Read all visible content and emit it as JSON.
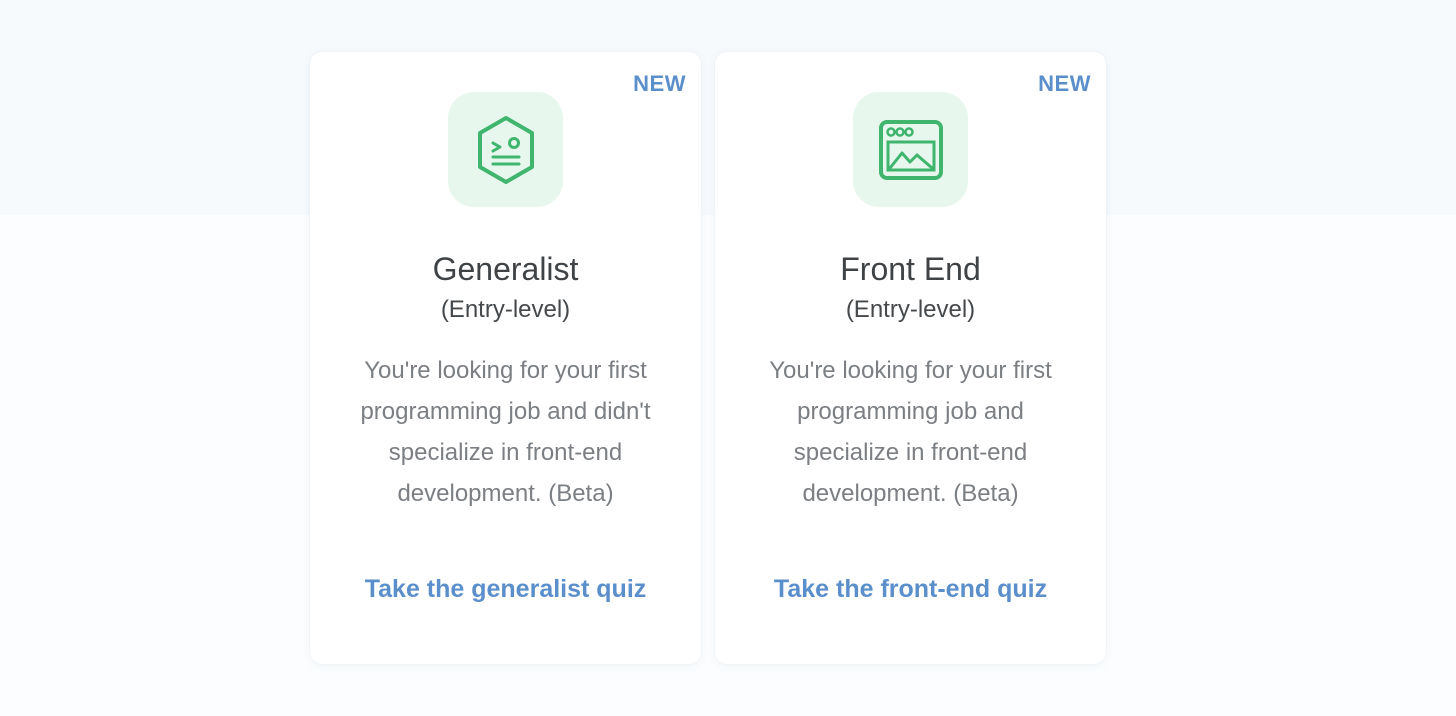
{
  "cards": [
    {
      "badge": "NEW",
      "icon": "terminal-hexagon-icon",
      "title": "Generalist",
      "subtitle": "(Entry-level)",
      "description_lines": [
        "You're looking for your first",
        "programming job and didn't",
        "specialize in front-end",
        "development. (Beta)"
      ],
      "cta": "Take the generalist quiz"
    },
    {
      "badge": "NEW",
      "icon": "browser-window-image-icon",
      "title": "Front End",
      "subtitle": "(Entry-level)",
      "description_lines": [
        "You're looking for your first",
        "programming job and",
        "specialize in front-end",
        "development. (Beta)"
      ],
      "cta": "Take the front-end quiz"
    }
  ],
  "colors": {
    "accent": "#5b8fcb",
    "icon_green": "#3fb56e",
    "icon_bg": "#e8f7ee",
    "title": "#3f4346",
    "body": "#7b7f83"
  }
}
